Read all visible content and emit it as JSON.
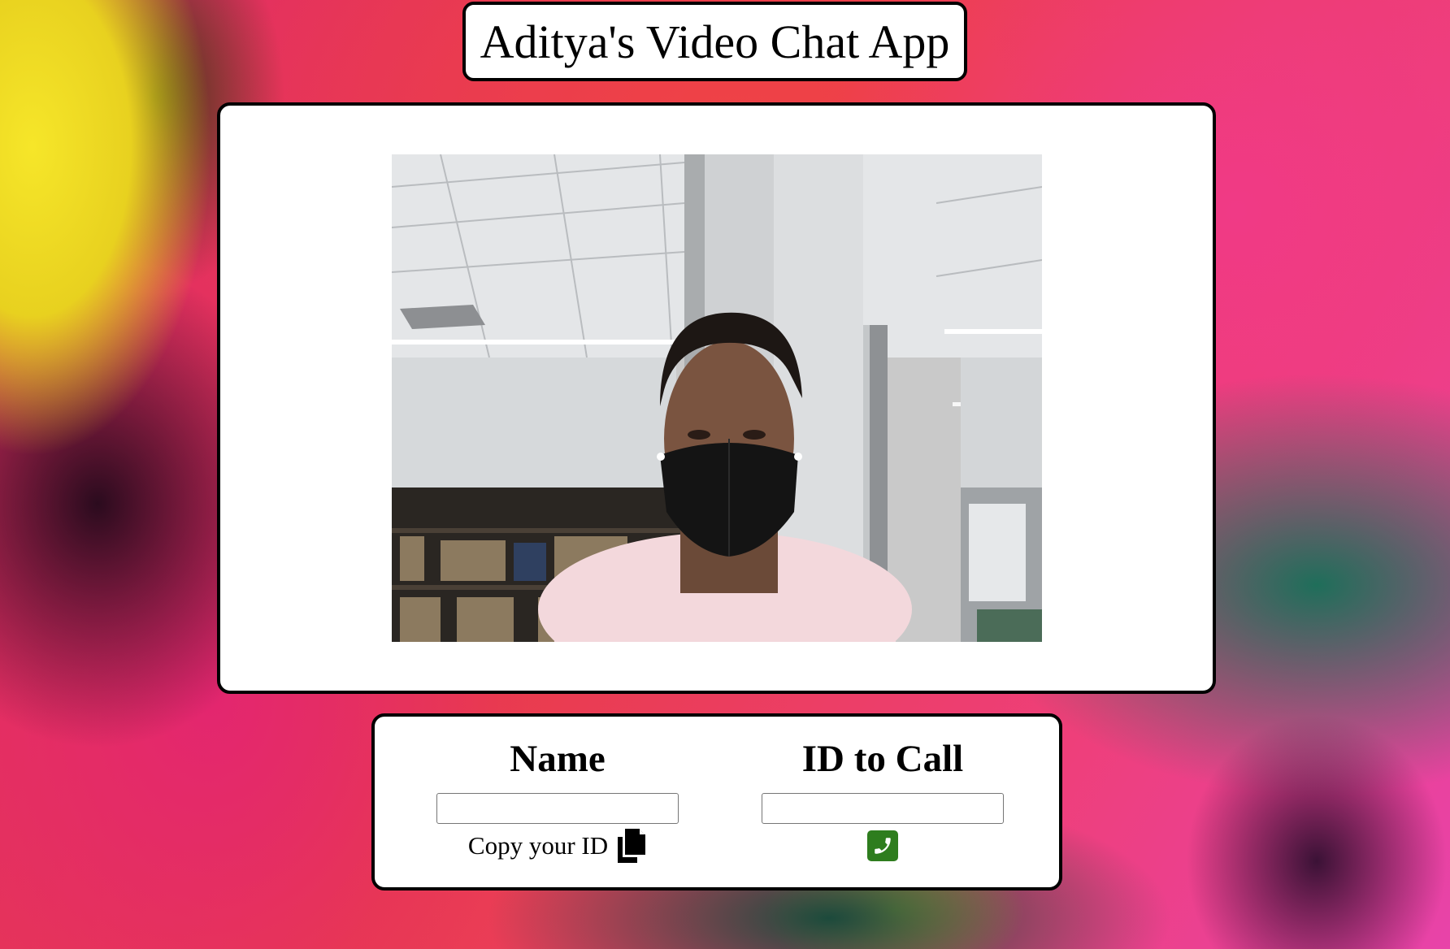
{
  "header": {
    "title": "Aditya's Video Chat App"
  },
  "video": {
    "description_icon": "webcam-feed"
  },
  "controls": {
    "name_heading": "Name",
    "name_value": "",
    "copy_label": "Copy your ID",
    "copy_icon": "copy-icon",
    "id_heading": "ID to Call",
    "id_value": "",
    "call_icon": "phone-icon",
    "call_button_color": "#2e7d1e"
  },
  "colors": {
    "panel_background": "#ffffff",
    "panel_border": "#000000"
  }
}
